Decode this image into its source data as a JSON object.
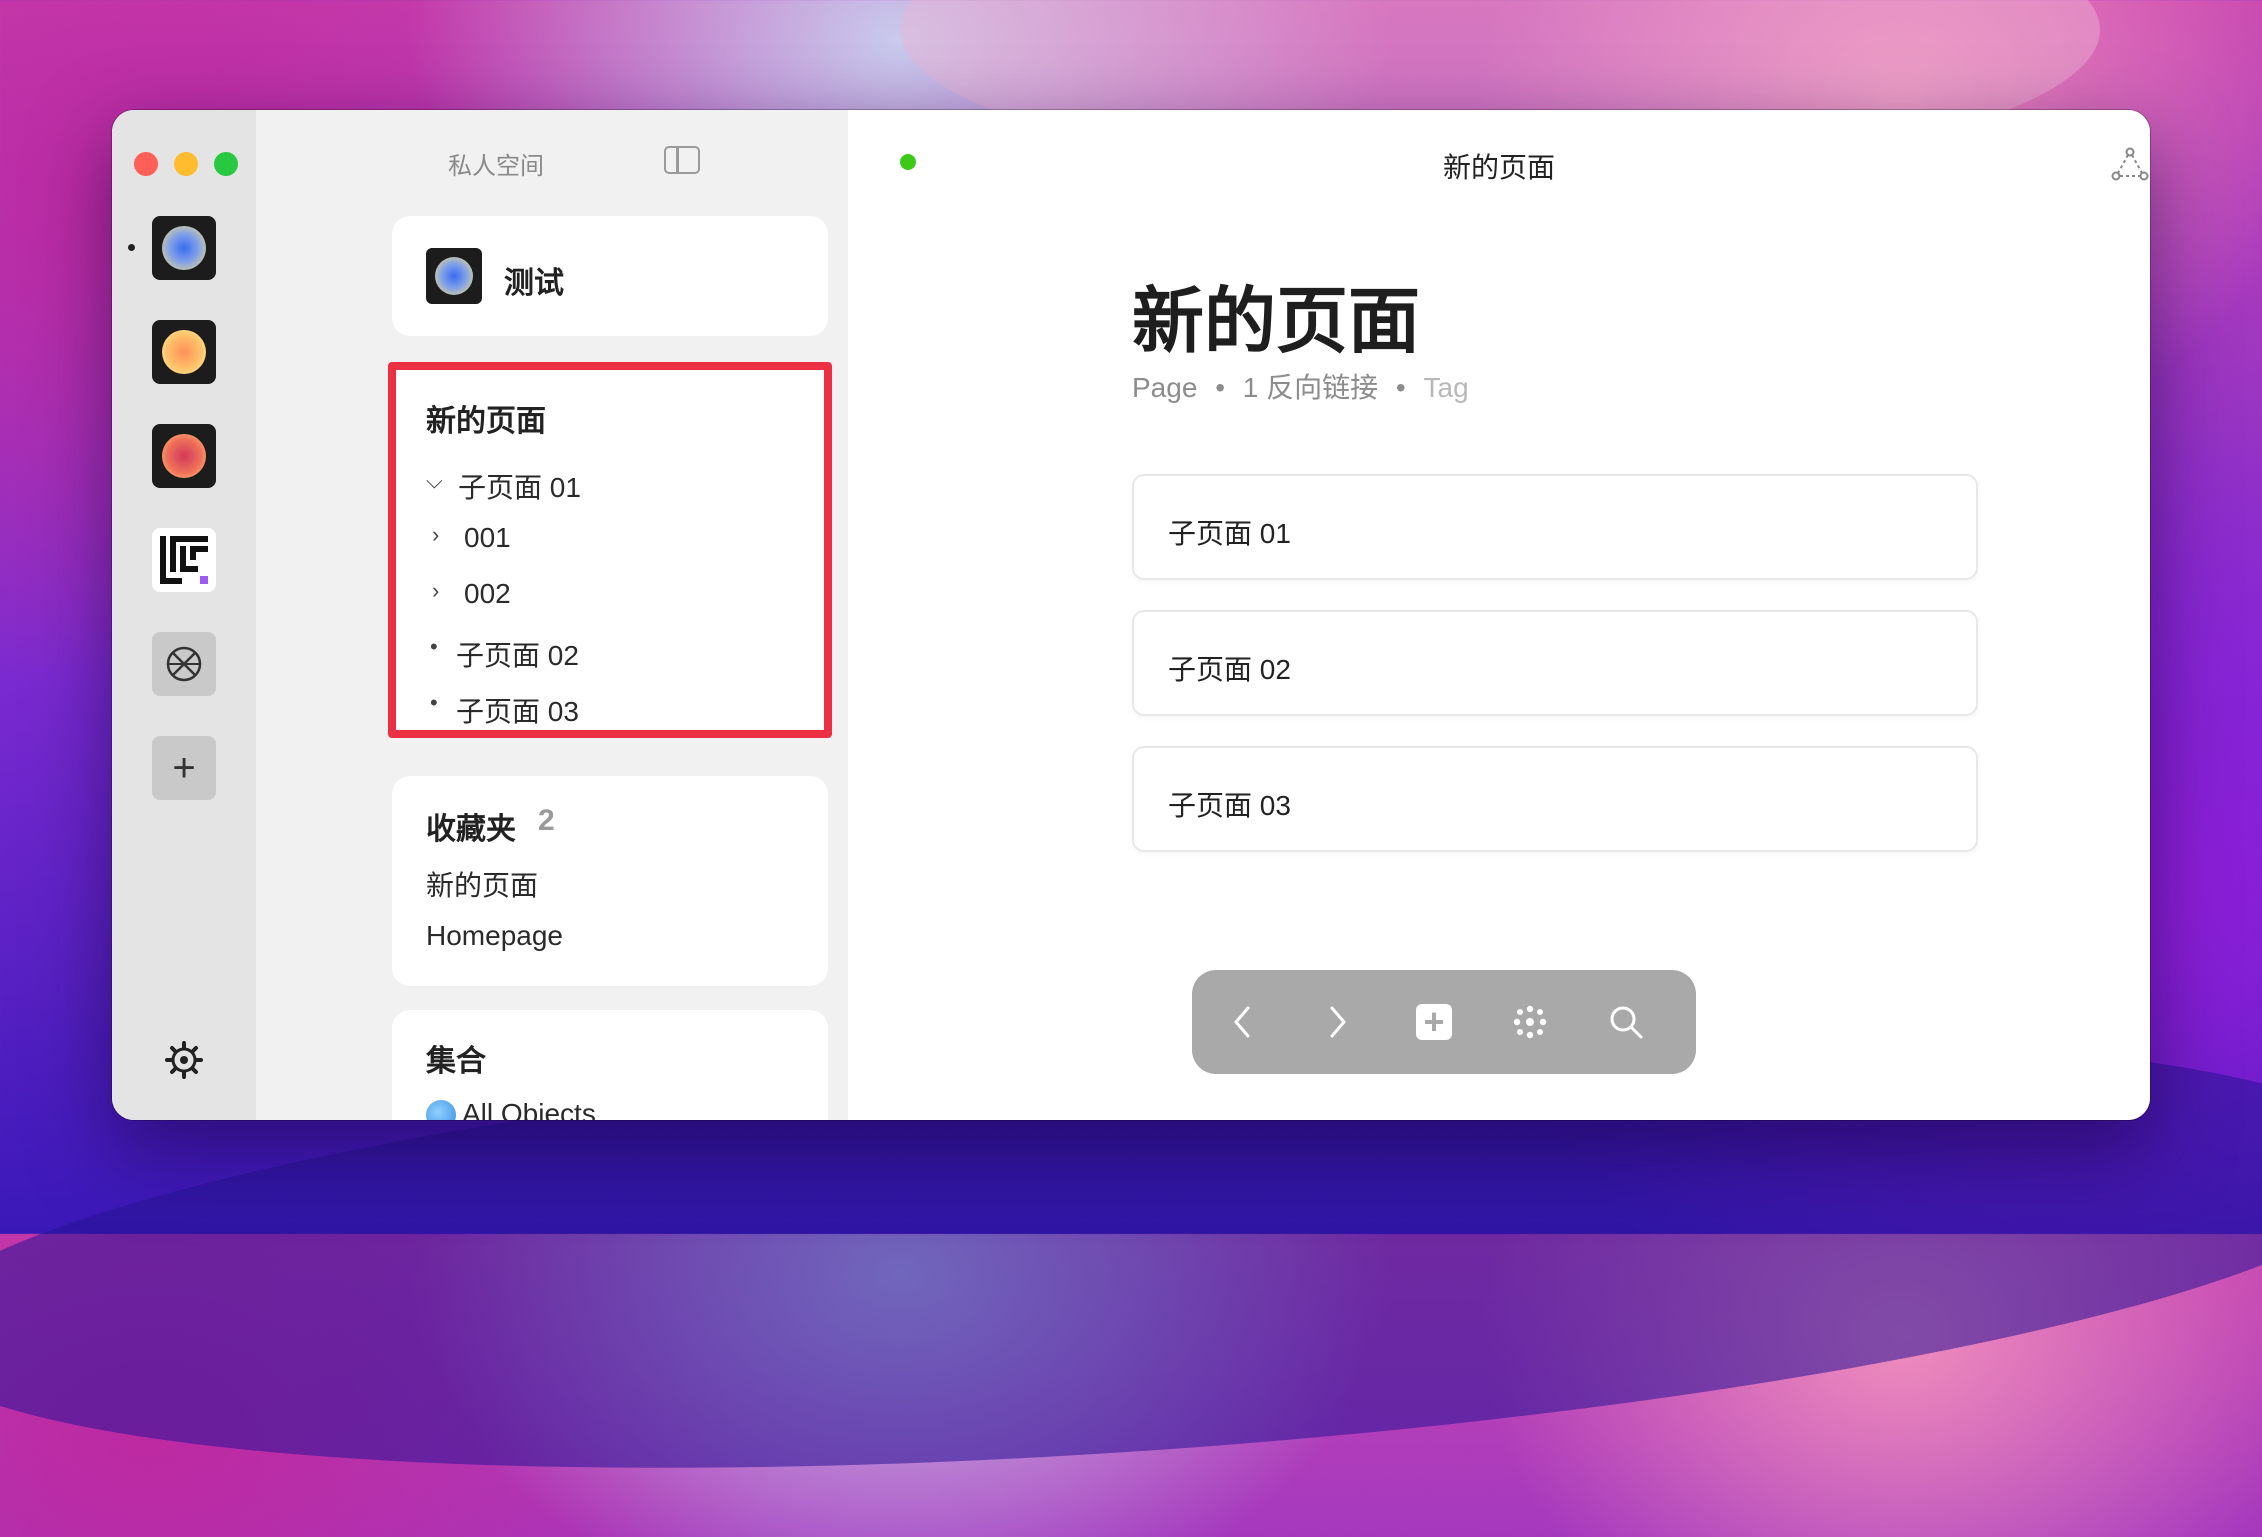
{
  "sidebar": {
    "title": "私人空间",
    "space_name": "测试",
    "tree": {
      "title": "新的页面",
      "items": [
        {
          "label": "子页面 01",
          "expander": "chevron-down"
        },
        {
          "label": "001",
          "expander": "chevron-right"
        },
        {
          "label": "002",
          "expander": "chevron-right"
        },
        {
          "label": "子页面 02",
          "expander": "bullet"
        },
        {
          "label": "子页面 03",
          "expander": "bullet"
        }
      ]
    },
    "favorites": {
      "title": "收藏夹",
      "count": "2",
      "items": [
        "新的页面",
        "Homepage"
      ]
    },
    "sets": {
      "title": "集合",
      "items": [
        "All Objects"
      ]
    }
  },
  "header": {
    "title": "新的页面"
  },
  "page": {
    "title": "新的页面",
    "type": "Page",
    "backlinks": "1 反向链接",
    "tag": "Tag",
    "links": [
      "子页面 01",
      "子页面 02",
      "子页面 03"
    ]
  },
  "icons": {
    "rail": [
      "space-orb-blue-icon",
      "space-orb-yellow-icon",
      "space-orb-red-icon",
      "brand-logo-icon",
      "compass-icon",
      "plus-icon",
      "settings-gear-icon"
    ],
    "toolbar": [
      "chevron-left-icon",
      "chevron-right-icon",
      "plus-square-icon",
      "graph-dots-icon",
      "search-icon"
    ]
  },
  "colors": {
    "highlight_border": "#ec3044",
    "status_dot": "#3ec916",
    "toolbar_bg": "#a9a9a9"
  }
}
